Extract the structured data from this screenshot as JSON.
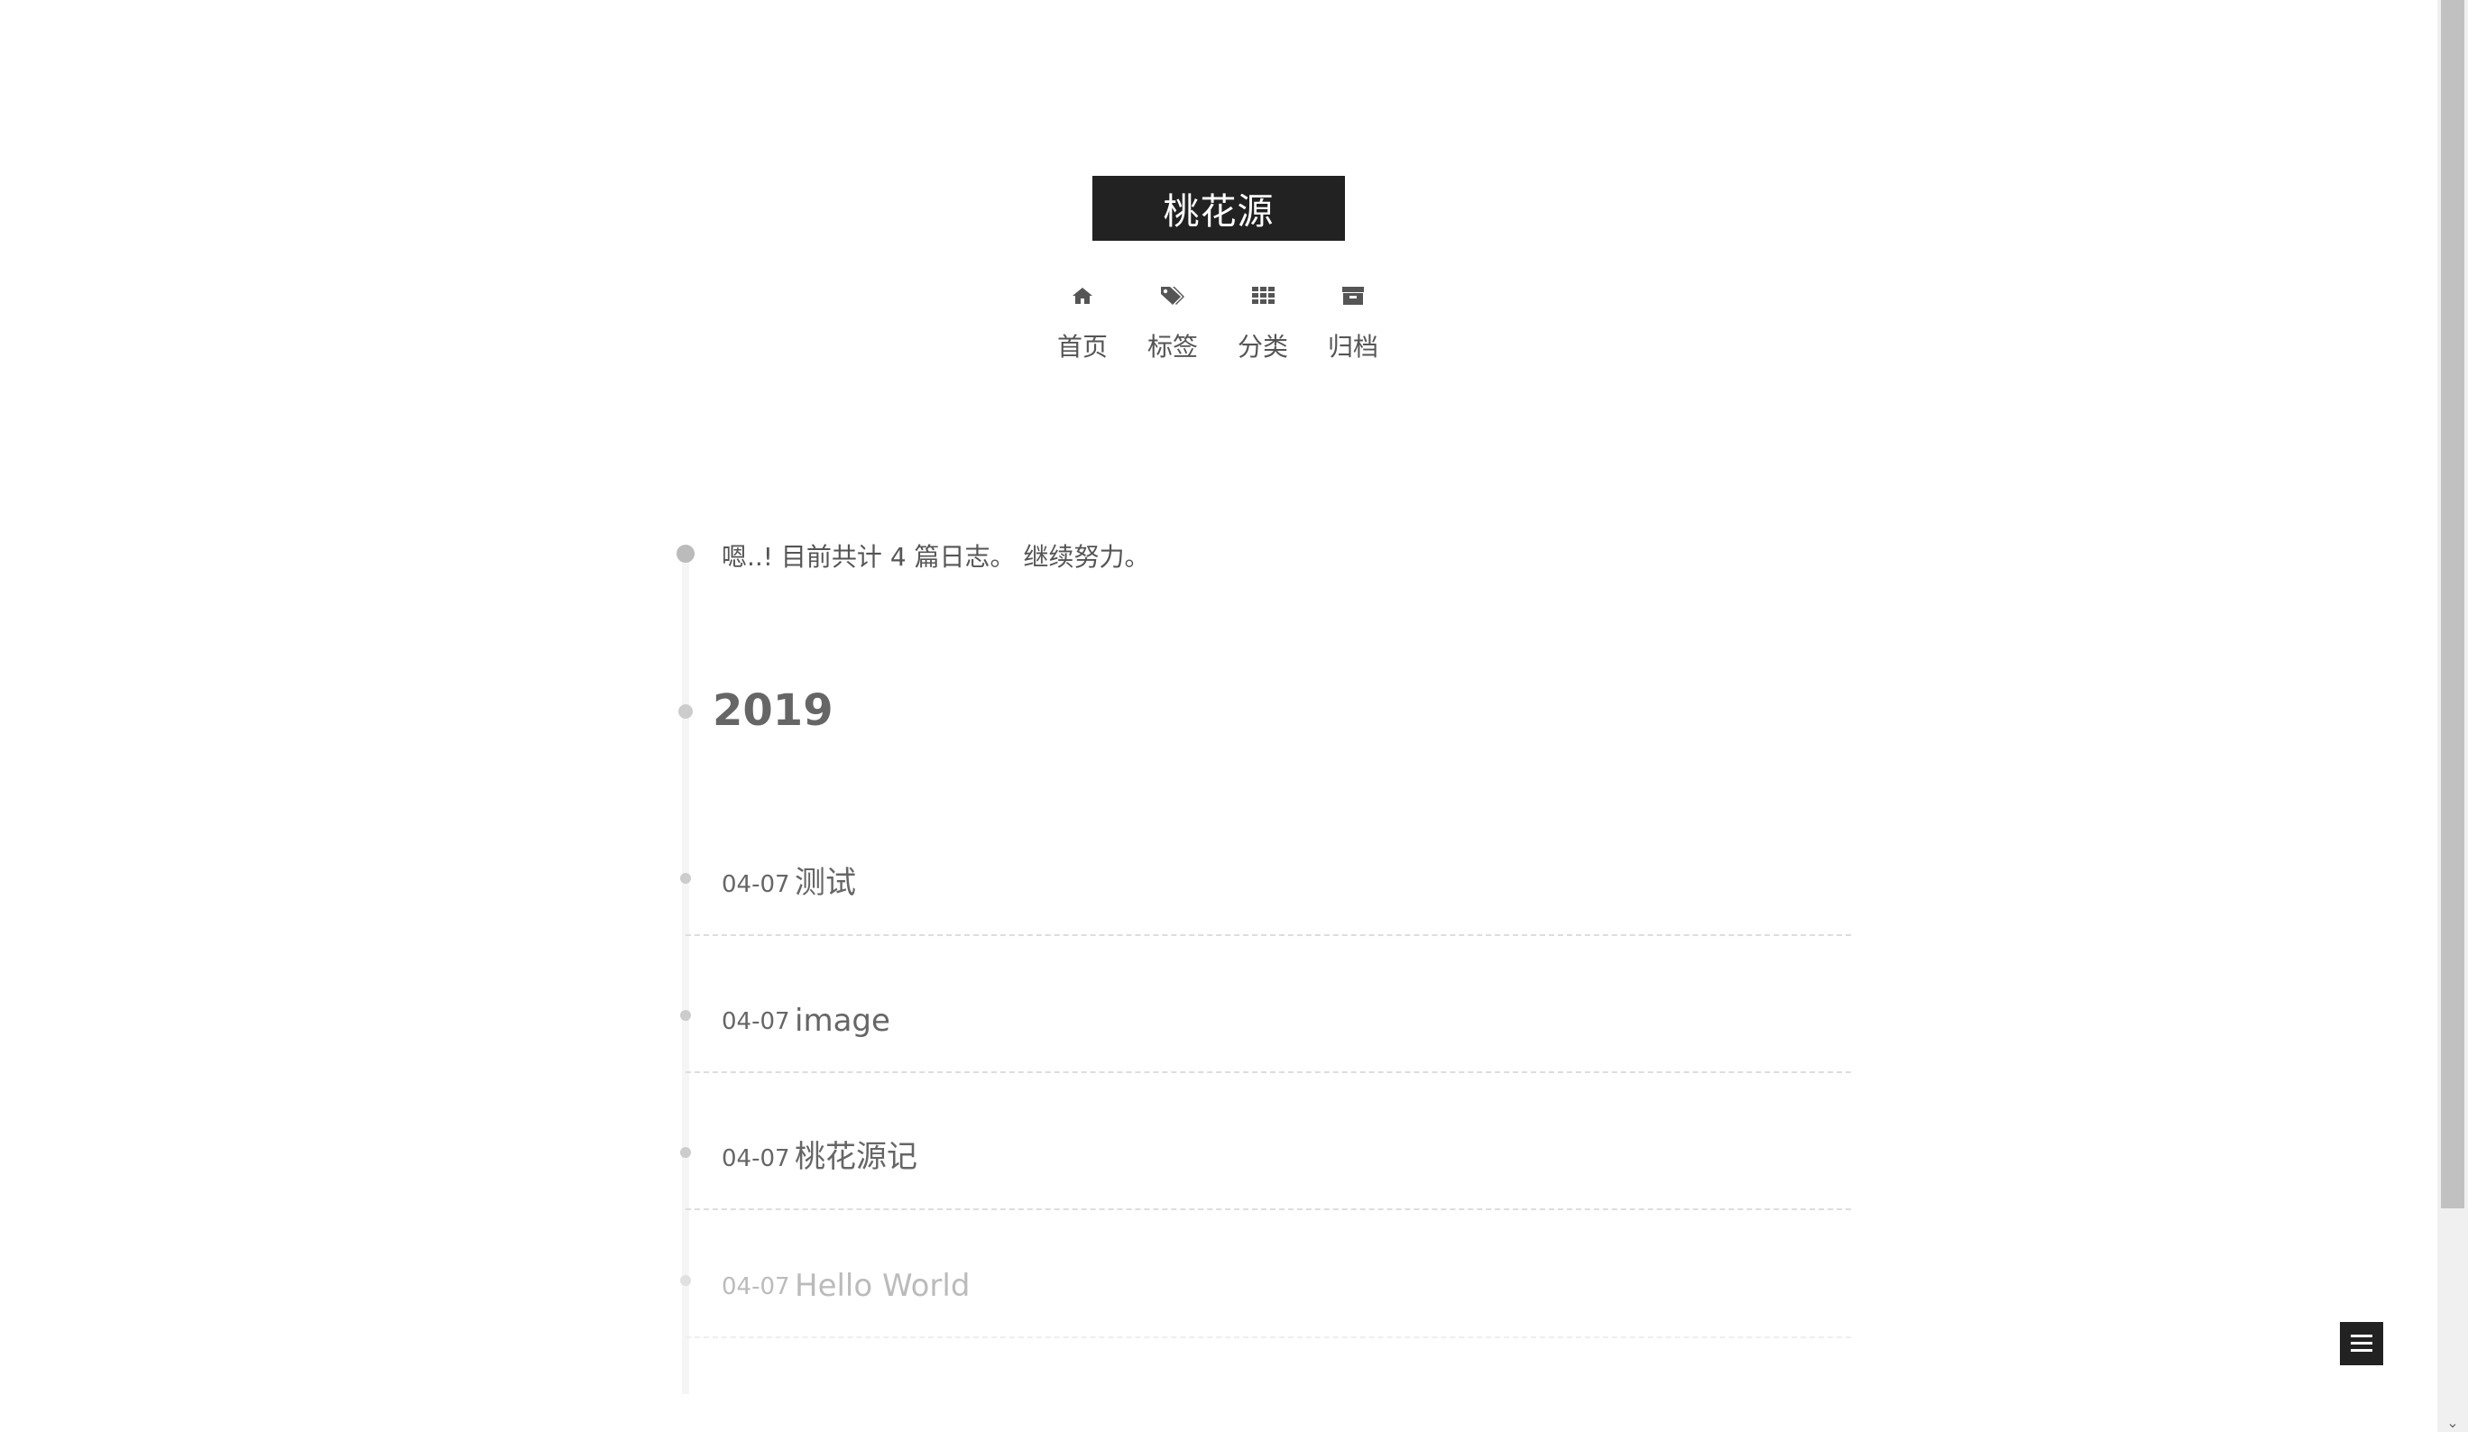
{
  "site": {
    "title": "桃花源"
  },
  "nav": {
    "items": [
      {
        "label": "首页",
        "icon": "home-icon"
      },
      {
        "label": "标签",
        "icon": "tags-icon"
      },
      {
        "label": "分类",
        "icon": "th-icon"
      },
      {
        "label": "归档",
        "icon": "archive-icon"
      }
    ]
  },
  "archive": {
    "summary": "嗯..! 目前共计 4 篇日志。 继续努力。",
    "year": "2019",
    "posts": [
      {
        "date": "04-07",
        "title": "测试"
      },
      {
        "date": "04-07",
        "title": "image"
      },
      {
        "date": "04-07",
        "title": "桃花源记"
      },
      {
        "date": "04-07",
        "title": "Hello World"
      }
    ]
  },
  "colors": {
    "brand_bg": "#222222",
    "text": "#555555",
    "muted": "#bbbbbb"
  }
}
